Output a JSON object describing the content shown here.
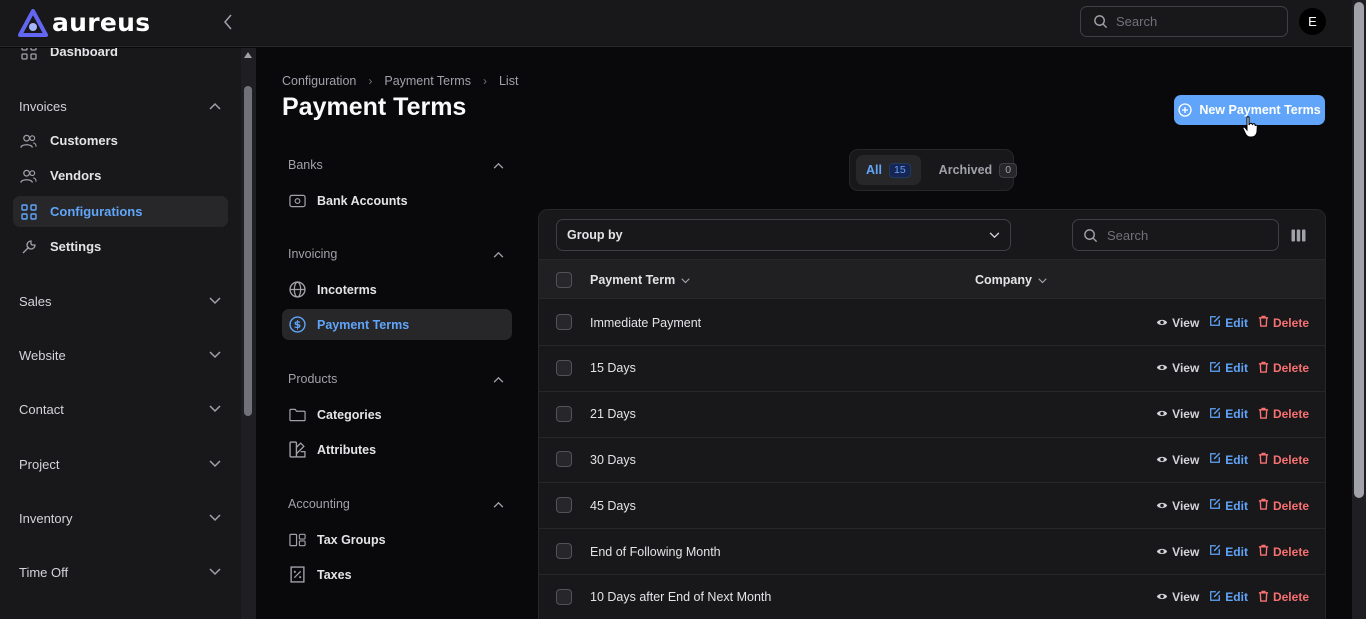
{
  "app": {
    "name": "aureus",
    "avatar_initial": "E"
  },
  "header": {
    "search_placeholder": "Search"
  },
  "sidebar": {
    "items": [
      {
        "label": "Dashboard",
        "icon": "dashboard-icon"
      },
      {
        "label": "Customers",
        "icon": "users-icon"
      },
      {
        "label": "Vendors",
        "icon": "users-icon"
      },
      {
        "label": "Configurations",
        "icon": "grid-icon",
        "active": true
      },
      {
        "label": "Settings",
        "icon": "wrench-icon"
      }
    ],
    "groups": [
      "Invoices",
      "Sales",
      "Website",
      "Contact",
      "Project",
      "Inventory",
      "Time Off"
    ]
  },
  "breadcrumb": [
    "Configuration",
    "Payment Terms",
    "List"
  ],
  "page_title": "Payment Terms",
  "new_button_label": "New Payment Terms",
  "subnav": {
    "groups": [
      "Banks",
      "Invoicing",
      "Products",
      "Accounting"
    ],
    "items": [
      "Bank Accounts",
      "Incoterms",
      "Payment Terms",
      "Categories",
      "Attributes",
      "Tax Groups",
      "Taxes"
    ]
  },
  "tabs": [
    {
      "label": "All",
      "count": "15",
      "active": true
    },
    {
      "label": "Archived",
      "count": "0"
    }
  ],
  "table": {
    "group_by_label": "Group by",
    "search_placeholder": "Search",
    "columns": [
      "Payment Term",
      "Company"
    ],
    "rows": [
      "Immediate Payment",
      "15 Days",
      "21 Days",
      "30 Days",
      "45 Days",
      "End of Following Month",
      "10 Days after End of Next Month"
    ],
    "actions": {
      "view": "View",
      "edit": "Edit",
      "delete": "Delete"
    }
  },
  "colors": {
    "accent": "#60a5fa",
    "danger": "#f87171",
    "background": "#09090b",
    "panel": "#18181b"
  }
}
